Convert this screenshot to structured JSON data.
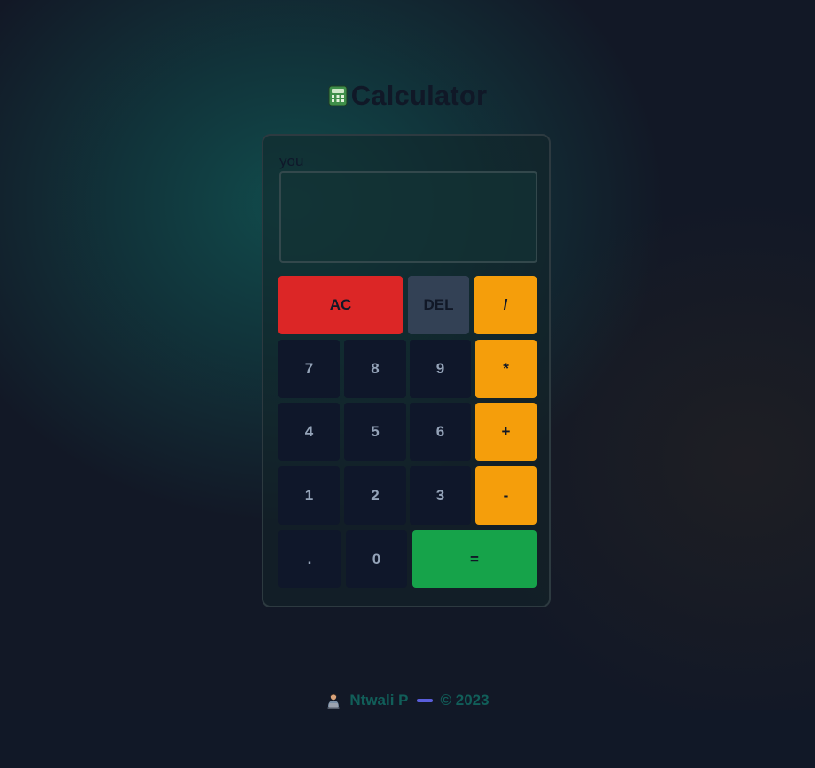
{
  "app": {
    "title": "Calculator",
    "title_icon": "calculator-icon"
  },
  "display": {
    "label": "you",
    "value": ""
  },
  "keys": {
    "ac": "AC",
    "del": "DEL",
    "divide": "/",
    "multiply": "*",
    "plus": "+",
    "minus": "-",
    "equals": "=",
    "dot": ".",
    "d0": "0",
    "d1": "1",
    "d2": "2",
    "d3": "3",
    "d4": "4",
    "d5": "5",
    "d6": "6",
    "d7": "7",
    "d8": "8",
    "d9": "9"
  },
  "footer": {
    "icon": "technologist-icon",
    "author": "Ntwali P",
    "copyright": "© 2023"
  },
  "colors": {
    "background": "#121826",
    "accent_glow": "#105c58",
    "clear_key": "#dc2626",
    "delete_key": "#334155",
    "operator_key": "#f59e0b",
    "number_key": "#0f172a",
    "equals_key": "#16a34a",
    "footer_text": "#115e59",
    "footer_dash": "#6366f1"
  }
}
